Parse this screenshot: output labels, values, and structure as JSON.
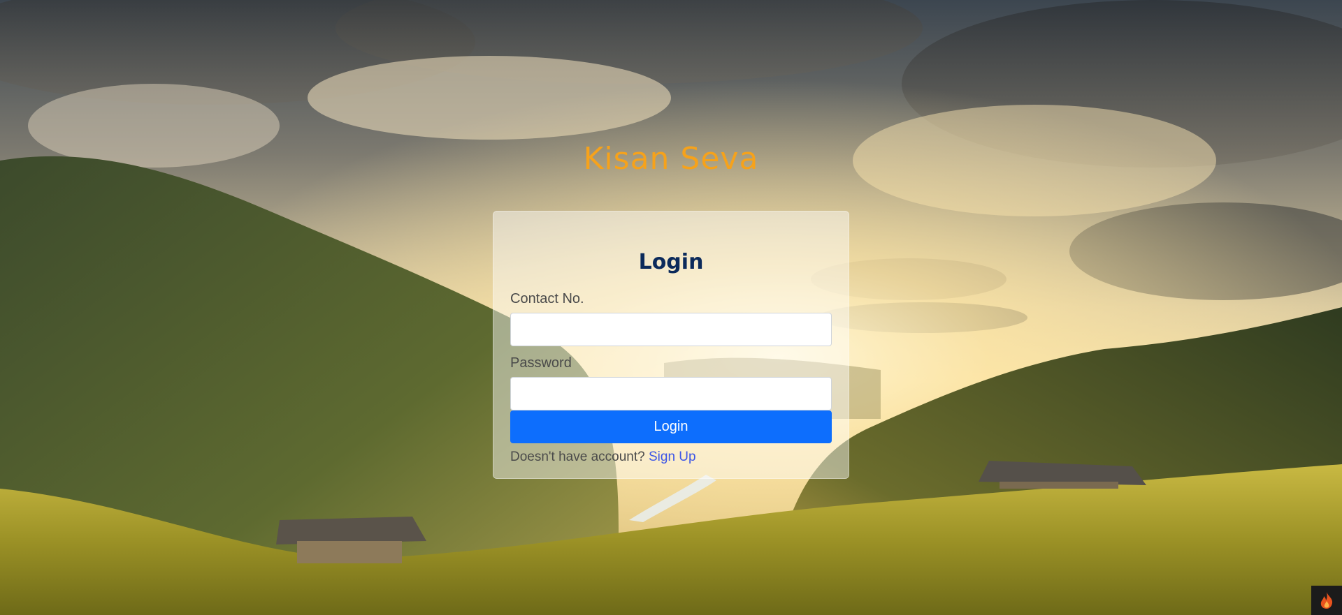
{
  "brand": {
    "title": "Kisan Seva"
  },
  "login_form": {
    "heading": "Login",
    "contact_label": "Contact No.",
    "contact_value": "",
    "contact_placeholder": "",
    "password_label": "Password",
    "password_value": "",
    "password_placeholder": "",
    "submit_label": "Login",
    "signup_prompt": "Doesn't have account?",
    "signup_link": "Sign Up"
  },
  "background": {
    "scene": "mountain-valley-rice-terrace-sunset"
  },
  "corner_badge": {
    "icon": "flame-icon"
  },
  "colors": {
    "brand": "#f6a21b",
    "heading": "#0b2a5b",
    "label": "#4a4a4a",
    "button": "#0d6efd",
    "link": "#3d56e6",
    "sky_top": "#4a5560",
    "sun": "#fff4cf",
    "grass": "#c7b43a",
    "mountain": "#3f4a25"
  }
}
